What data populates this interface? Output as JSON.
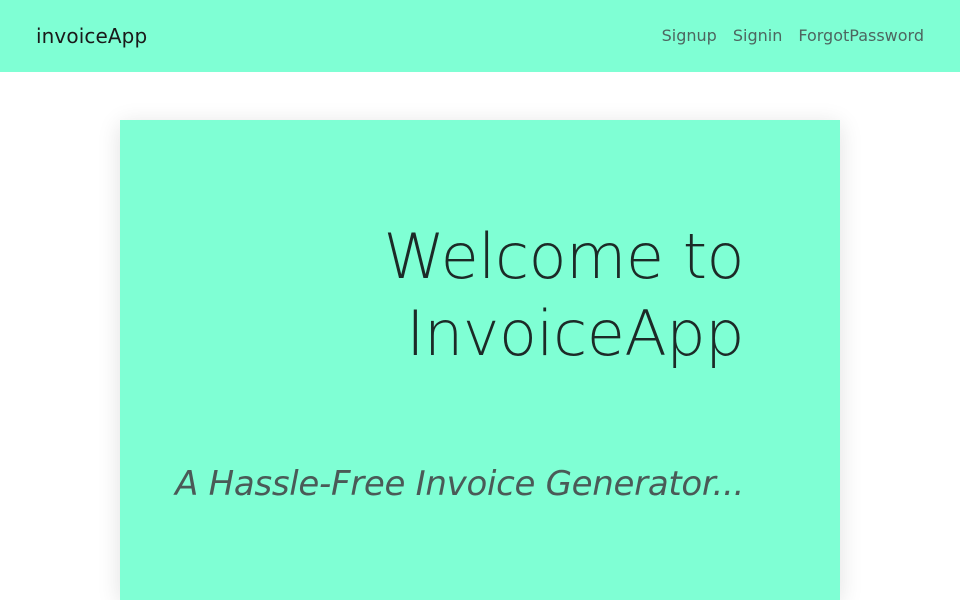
{
  "navbar": {
    "brand": "invoiceApp",
    "links": [
      {
        "label": "Signup"
      },
      {
        "label": "Signin"
      },
      {
        "label": "ForgotPassword"
      }
    ]
  },
  "hero": {
    "title_line1": "Welcome to",
    "title_line2": "InvoiceApp",
    "tagline": "A Hassle-Free Invoice Generator..."
  },
  "colors": {
    "accent": "#7fffd4",
    "background": "#ffffff"
  }
}
